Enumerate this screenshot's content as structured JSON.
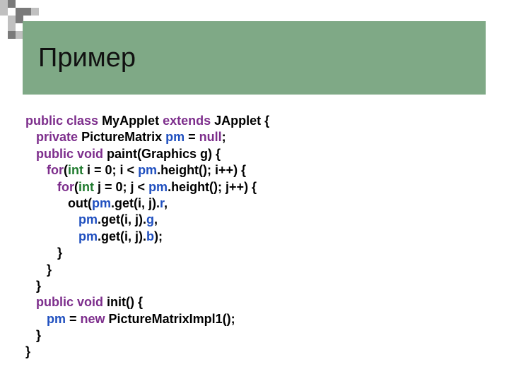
{
  "title": "Пример",
  "code": {
    "l1": {
      "kw1": "public class",
      "name": "MyApplet",
      "kw2": "extends",
      "base": "JApplet",
      "brace": " {"
    },
    "l2": {
      "indent": "   ",
      "kw": "private",
      "type": "PictureMatrix",
      "var": "pm",
      "eq": " = ",
      "val": "null",
      "semi": ";"
    },
    "l3": {
      "indent": "   ",
      "kw": "public void",
      "sig": " paint(Graphics g) {"
    },
    "l4": {
      "indent": "      ",
      "kw": "for",
      "open": "(",
      "type": "int",
      "decl": " i = 0; i < ",
      "var": "pm",
      "call": ".height(); i++) {"
    },
    "l5": {
      "indent": "         ",
      "kw": "for",
      "open": "(",
      "type": "int",
      "decl": " j = 0; j < ",
      "var": "pm",
      "call": ".height(); j++) {"
    },
    "l6": {
      "indent": "            ",
      "pre": "out(",
      "var": "pm",
      "mid": ".get(i, j).",
      "fld": "r",
      "tail": ","
    },
    "l7": {
      "indent": "               ",
      "var": "pm",
      "mid": ".get(i, j).",
      "fld": "g",
      "tail": ","
    },
    "l8": {
      "indent": "               ",
      "var": "pm",
      "mid": ".get(i, j).",
      "fld": "b",
      "tail": ");"
    },
    "l9": {
      "indent": "         ",
      "text": "}"
    },
    "l10": {
      "indent": "      ",
      "text": "}"
    },
    "l11": {
      "indent": "   ",
      "text": "}"
    },
    "l12": {
      "indent": "   ",
      "kw": "public void",
      "sig": " init() {"
    },
    "l13": {
      "indent": "      ",
      "var": "pm",
      "eq": " = ",
      "kw": "new",
      "ctor": " PictureMatrixImpl1();"
    },
    "l14": {
      "indent": "   ",
      "text": "}"
    },
    "l15": {
      "text": "}"
    }
  }
}
